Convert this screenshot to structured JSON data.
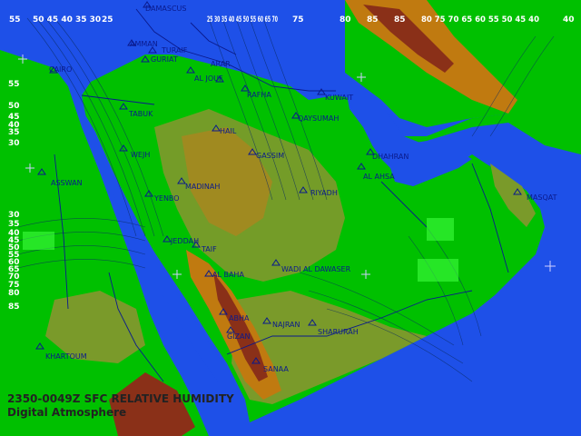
{
  "caption": {
    "product": "2350-0049Z SFC RELATIVE HUMIDITY",
    "source": "Digital Atmosphere"
  },
  "top_ticks": [
    "55",
    "50 45 40 35 30",
    "25",
    "25 30 35 40 45 50 55 60 65 70",
    "75",
    "80",
    "85",
    "85",
    "80 75 70 65 60 55 50 45 40",
    "40"
  ],
  "left_ticks": [
    "55",
    "50",
    "45",
    "40",
    "35",
    "30",
    "30",
    "35",
    "40",
    "45",
    "50",
    "55",
    "60",
    "65",
    "70",
    "75",
    "80",
    "85"
  ],
  "cities": [
    "DAMASCUS",
    "AMMAN",
    "TURAIF",
    "GURIAT",
    "CAIRO",
    "ARAR",
    "AL JOUF",
    "RAFHA",
    "KUWAIT",
    "TABUK",
    "QAYSUMAH",
    "HAIL",
    "DHAHRAN",
    "AL AHSA",
    "GASSIM",
    "WEJH",
    "ASSWAN",
    "MADINAH",
    "YENBO",
    "RIYADH",
    "MASQAT",
    "JEDDAH",
    "TAIF",
    "WADI AL DAWASER",
    "AL BAHA",
    "ABHA",
    "NAJRAN",
    "SHARURAH",
    "GIZAN",
    "SANAA",
    "KHARTOUM"
  ],
  "colors": {
    "water": "#1e50e8",
    "lowland": "#00c000",
    "plateau": "#7a9a2a",
    "highland": "#c07a10",
    "mountain": "#8a3018",
    "label_blue": "#0a1a8c"
  }
}
